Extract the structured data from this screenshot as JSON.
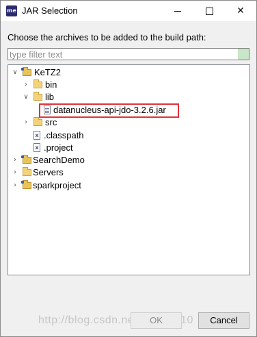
{
  "window": {
    "app_icon_text": "me",
    "title": "JAR Selection",
    "minimize_glyph": "",
    "close_glyph": "✕"
  },
  "prompt": "Choose the archives to be added to the build path:",
  "filter": {
    "placeholder": "type filter text",
    "value": ""
  },
  "tree": {
    "nodes": [
      {
        "label": "KeTZ2",
        "icon": "project-icon",
        "expanded": true
      },
      {
        "label": "bin",
        "icon": "folder-icon",
        "expanded": false
      },
      {
        "label": "lib",
        "icon": "folder-icon",
        "expanded": true
      },
      {
        "label": "datanucleus-api-jdo-3.2.6.jar",
        "icon": "jar-file-icon",
        "highlighted": true
      },
      {
        "label": "src",
        "icon": "folder-icon",
        "expanded": false
      },
      {
        "label": ".classpath",
        "icon": "xml-file-icon"
      },
      {
        "label": ".project",
        "icon": "xml-file-icon"
      },
      {
        "label": "SearchDemo",
        "icon": "project-icon",
        "expanded": false
      },
      {
        "label": "Servers",
        "icon": "folder-icon",
        "expanded": false
      },
      {
        "label": "sparkproject",
        "icon": "project-icon",
        "expanded": false
      }
    ],
    "highlight_color": "#e0323a"
  },
  "watermark": "http://blog.csdn.net/tiaozi0110",
  "buttons": {
    "ok": "OK",
    "cancel": "Cancel"
  }
}
